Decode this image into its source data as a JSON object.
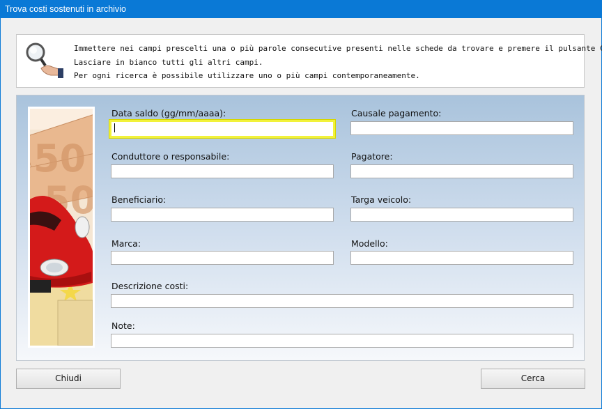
{
  "window": {
    "title": "Trova costi sostenuti in archivio"
  },
  "info": {
    "icon": "magnifier-icon",
    "lines": [
      "Immettere nei campi prescelti una o più parole consecutive presenti nelle schede da trovare e premere il pulsante Cerca.",
      "Lasciare in bianco tutti gli altri campi.",
      "Per ogni ricerca è possibile utilizzare uno o più campi contemporaneamente."
    ]
  },
  "image": {
    "subject": "red car on euro banknotes"
  },
  "fields": {
    "data_saldo": {
      "label": "Data saldo (gg/mm/aaaa):",
      "value": ""
    },
    "causale": {
      "label": "Causale pagamento:",
      "value": ""
    },
    "conduttore": {
      "label": "Conduttore o responsabile:",
      "value": ""
    },
    "pagatore": {
      "label": "Pagatore:",
      "value": ""
    },
    "beneficiario": {
      "label": "Beneficiario:",
      "value": ""
    },
    "targa": {
      "label": "Targa veicolo:",
      "value": ""
    },
    "marca": {
      "label": "Marca:",
      "value": ""
    },
    "modello": {
      "label": "Modello:",
      "value": ""
    },
    "descrizione": {
      "label": "Descrizione costi:",
      "value": ""
    },
    "note": {
      "label": "Note:",
      "value": ""
    }
  },
  "buttons": {
    "close": "Chiudi",
    "search": "Cerca"
  },
  "colors": {
    "titlebar": "#0a79d6",
    "focus_border": "#f2f23a"
  }
}
